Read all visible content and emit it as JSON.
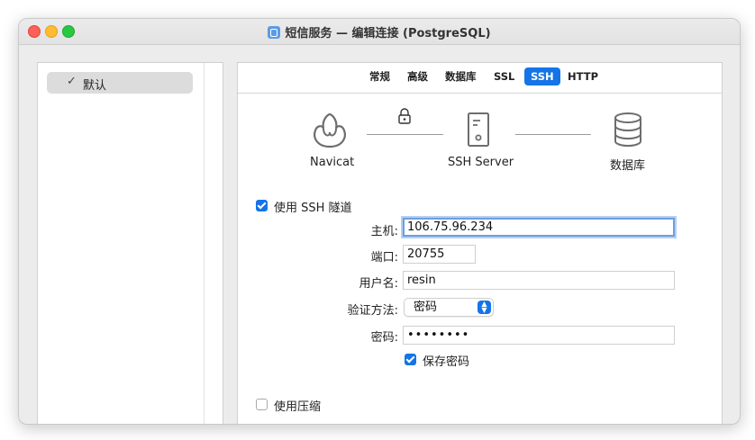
{
  "window": {
    "title": "短信服务 — 编辑连接 (PostgreSQL)"
  },
  "sidebar": {
    "items": [
      {
        "check": "✓",
        "label": "默认"
      }
    ]
  },
  "tabs": [
    {
      "label": "常规",
      "active": false
    },
    {
      "label": "高级",
      "active": false
    },
    {
      "label": "数据库",
      "active": false
    },
    {
      "label": "SSL",
      "active": false
    },
    {
      "label": "SSH",
      "active": true
    },
    {
      "label": "HTTP",
      "active": false
    }
  ],
  "diagram": {
    "navicat_label": "Navicat",
    "ssh_server_label": "SSH Server",
    "database_label": "数据库"
  },
  "ssh": {
    "use_tunnel_label": "使用 SSH 隧道",
    "use_tunnel_checked": true,
    "host_label": "主机:",
    "host_value": "106.75.96.234",
    "port_label": "端口:",
    "port_value": "20755",
    "username_label": "用户名:",
    "username_value": "resin",
    "auth_label": "验证方法:",
    "auth_value": "密码",
    "password_label": "密码:",
    "password_value": "••••••••",
    "save_password_label": "保存密码",
    "save_password_checked": true,
    "compression_label": "使用压缩",
    "compression_checked": false
  },
  "colors": {
    "accent": "#1474e8",
    "focus_ring": "#6b9fe0"
  }
}
